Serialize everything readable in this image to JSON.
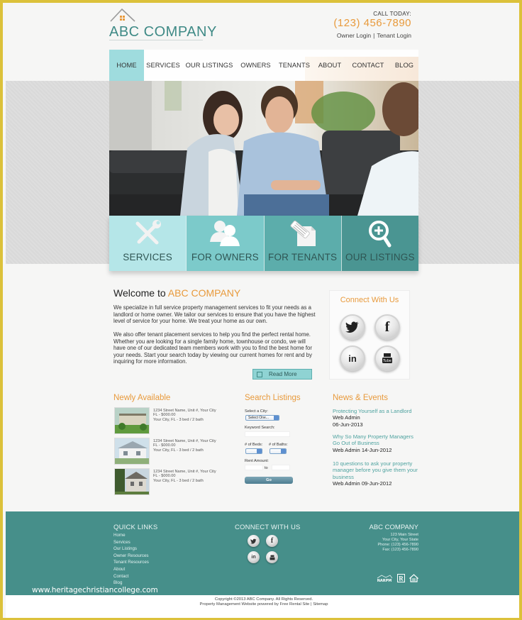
{
  "header": {
    "logo_text": "ABC COMPANY",
    "call_label": "CALL TODAY:",
    "phone": "(123) 456-7890",
    "owner_login": "Owner Login",
    "login_separator": "|",
    "tenant_login": "Tenant Login"
  },
  "nav": {
    "items": [
      {
        "label": "HOME",
        "active": true
      },
      {
        "label": "SERVICES"
      },
      {
        "label": "OUR LISTINGS"
      },
      {
        "label": "OWNERS"
      },
      {
        "label": "TENANTS"
      },
      {
        "label": "ABOUT"
      },
      {
        "label": "CONTACT"
      },
      {
        "label": "BLOG"
      }
    ]
  },
  "tiles": [
    {
      "label": "SERVICES",
      "icon": "tools-icon"
    },
    {
      "label": "FOR OWNERS",
      "icon": "users-icon"
    },
    {
      "label": "FOR TENANTS",
      "icon": "document-pencil-icon"
    },
    {
      "label": "OUR LISTINGS",
      "icon": "magnify-plus-icon"
    }
  ],
  "welcome": {
    "title_prefix": "Welcome to",
    "title_accent": "ABC COMPANY",
    "paragraph1": "We specialize in full service property management services to fit your needs as a landlord or home owner. We tailor our services to ensure that you have the highest level of service for your home. We treat your home as our own.",
    "paragraph2": "We also offer tenant placement services to help you find the perfect rental home. Whether you are looking for a single family home, townhouse or condo, we will have one of our dedicated team members work with you to find the best home for your needs. Start your search today by viewing our current homes for rent and by inquiring for more information.",
    "read_more": "Read More"
  },
  "connect_box": {
    "title": "Connect With Us",
    "networks": [
      "twitter",
      "facebook",
      "linkedin",
      "youtube"
    ]
  },
  "newly_available": {
    "title": "Newly Available",
    "listings": [
      {
        "address": "1234 Street Name, Unit #, Your City",
        "price": "FL - $000.00",
        "details": "Your City, FL -   3 bed / 2 bath"
      },
      {
        "address": "1234 Street Name, Unit #, Your City",
        "price": "FL - $000.00",
        "details": "Your City, FL -   3 bed / 2 bath"
      },
      {
        "address": "1234 Street Name, Unit #, Your City",
        "price": "FL - $000.00",
        "details": "Your City, FL -   3 bed / 2 bath"
      }
    ]
  },
  "search": {
    "title": "Search Listings",
    "city_label": "Select a City:",
    "city_value": "Select One...",
    "keyword_label": "Keyword Search:",
    "keyword_value": "",
    "beds_label": "# of Beds:",
    "baths_label": "# of Baths:",
    "beds_value": "",
    "baths_value": "",
    "rent_label": "Rent Amount:",
    "rent_to": "to",
    "rent_min": "",
    "rent_max": "",
    "go": "Go"
  },
  "news": {
    "title": "News & Events",
    "items": [
      {
        "title": "Protecting Yourself as a Landlord",
        "author": "Web Admin",
        "date": "06-Jun-2013"
      },
      {
        "title": "Why So Many Property Managers Go Out of Business",
        "author": "Web Admin",
        "date": "14-Jun-2012"
      },
      {
        "title": "10 questions to ask your property manager before you give them your business",
        "author": "Web Admin",
        "date": "09-Jun-2012"
      }
    ]
  },
  "footer": {
    "quick_links_title": "QUICK LINKS",
    "quick_links": [
      "Home",
      "Services",
      "Our Listings",
      "Owner Resources",
      "Tenant Resources",
      "About",
      "Contact",
      "Blog"
    ],
    "connect_title": "CONNECT WITH US",
    "company_title": "ABC COMPANY",
    "address_lines": [
      "123 Main Street",
      "Your City, Your State",
      "Phone: (123) 456-7890",
      "Fax: (123) 456-7890"
    ],
    "badges": [
      "NARPM",
      "REALTOR",
      "Equal Housing Opportunity"
    ]
  },
  "watermark": "www.heritagechristiancollege.com",
  "bottom": {
    "copyright": "Copyright ©2013 ABC Company. All Rights Reserved.",
    "powered_by": "Property Management Website powered by Free Rental Site",
    "separator": "|",
    "sitemap": "Sitemap"
  },
  "colors": {
    "accent_orange": "#e89a3c",
    "teal": "#468f8a",
    "nav_active": "#9fdcde",
    "border_yellow": "#dcc13a"
  }
}
